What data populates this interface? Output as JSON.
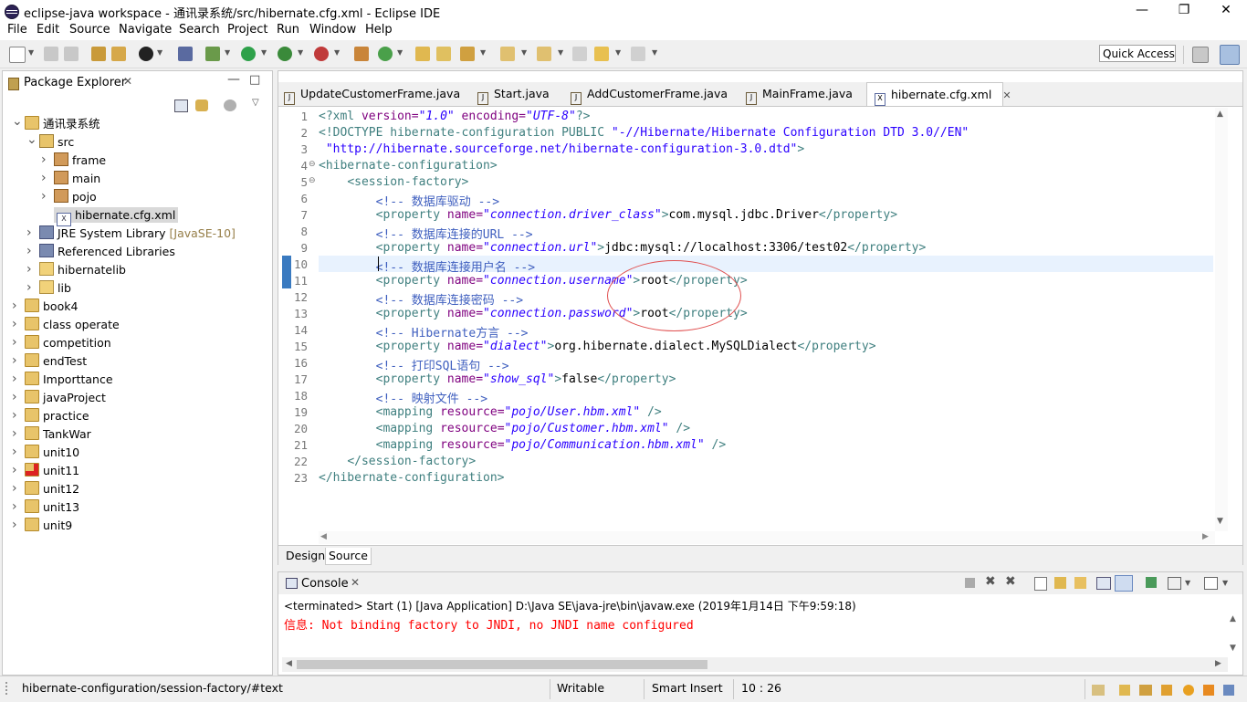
{
  "window": {
    "title": "eclipse-java workspace - 通讯录系统/src/hibernate.cfg.xml - Eclipse IDE",
    "minimize": "—",
    "restore": "❐",
    "close": "✕"
  },
  "menu": [
    "File",
    "Edit",
    "Source",
    "Navigate",
    "Search",
    "Project",
    "Run",
    "Window",
    "Help"
  ],
  "toolbar": {
    "quick_access": "Quick Access"
  },
  "package_explorer": {
    "title": "Package Explorer",
    "tree": [
      {
        "label": "通讯录系统",
        "icon": "project-icon",
        "expanded": true
      },
      {
        "label": "src",
        "icon": "source-folder-icon",
        "expanded": true
      },
      {
        "label": "frame",
        "icon": "package-icon"
      },
      {
        "label": "main",
        "icon": "package-icon"
      },
      {
        "label": "pojo",
        "icon": "package-icon"
      },
      {
        "label": "hibernate.cfg.xml",
        "icon": "xml-file-icon",
        "selected": true
      },
      {
        "label": "JRE System Library",
        "suffix": "[JavaSE-10]",
        "icon": "library-icon"
      },
      {
        "label": "Referenced Libraries",
        "icon": "library-icon"
      },
      {
        "label": "hibernatelib",
        "icon": "folder-icon"
      },
      {
        "label": "lib",
        "icon": "folder-icon"
      },
      {
        "label": "book4",
        "icon": "project-icon"
      },
      {
        "label": "class operate",
        "icon": "project-icon"
      },
      {
        "label": "competition",
        "icon": "project-icon"
      },
      {
        "label": "endTest",
        "icon": "project-icon"
      },
      {
        "label": "Importtance",
        "icon": "project-icon"
      },
      {
        "label": "javaProject",
        "icon": "project-icon"
      },
      {
        "label": "practice",
        "icon": "project-icon"
      },
      {
        "label": "TankWar",
        "icon": "project-icon"
      },
      {
        "label": "unit10",
        "icon": "project-icon"
      },
      {
        "label": "unit11",
        "icon": "project-icon-error"
      },
      {
        "label": "unit12",
        "icon": "project-icon"
      },
      {
        "label": "unit13",
        "icon": "project-icon"
      },
      {
        "label": "unit9",
        "icon": "project-icon"
      }
    ]
  },
  "editor": {
    "tabs": [
      {
        "label": "UpdateCustomerFrame.java"
      },
      {
        "label": "Start.java"
      },
      {
        "label": "AddCustomerFrame.java"
      },
      {
        "label": "MainFrame.java"
      },
      {
        "label": "hibernate.cfg.xml",
        "active": true
      }
    ],
    "bottom_tabs": [
      "Design",
      "Source"
    ],
    "lines": [
      [
        [
          "t-dt",
          "<?xml "
        ],
        [
          "t-attr",
          "version="
        ],
        [
          "t-val",
          "\"1.0\""
        ],
        [
          "t-attr",
          " encoding="
        ],
        [
          "t-val",
          "\"UTF-8\""
        ],
        [
          "t-dt",
          "?>"
        ]
      ],
      [
        [
          "t-dt",
          "<!DOCTYPE hibernate-configuration "
        ],
        [
          "t-dt",
          "PUBLIC "
        ],
        [
          "t-str",
          "\"-//Hibernate/Hibernate Configuration DTD 3.0//EN\""
        ]
      ],
      [
        [
          "t-str",
          " \"http://hibernate.sourceforge.net/hibernate-configuration-3.0.dtd\""
        ],
        [
          "t-dt",
          ">"
        ]
      ],
      [
        [
          "t-tag",
          "<hibernate-configuration>"
        ]
      ],
      [
        [
          "t-txt",
          "    "
        ],
        [
          "t-tag",
          "<session-factory>"
        ]
      ],
      [
        [
          "t-txt",
          "        "
        ],
        [
          "t-com",
          "<!-- 数据库驱动 -->"
        ]
      ],
      [
        [
          "t-txt",
          "        "
        ],
        [
          "t-tag",
          "<property "
        ],
        [
          "t-attr",
          "name="
        ],
        [
          "t-val",
          "\"connection.driver_class\""
        ],
        [
          "t-tag",
          ">"
        ],
        [
          "t-txt",
          "com.mysql.jdbc.Driver"
        ],
        [
          "t-tag",
          "</property>"
        ]
      ],
      [
        [
          "t-txt",
          "        "
        ],
        [
          "t-com",
          "<!-- 数据库连接的URL -->"
        ]
      ],
      [
        [
          "t-txt",
          "        "
        ],
        [
          "t-tag",
          "<property "
        ],
        [
          "t-attr",
          "name="
        ],
        [
          "t-val",
          "\"connection.url\""
        ],
        [
          "t-tag",
          ">"
        ],
        [
          "t-txt",
          "jdbc:mysql://localhost:3306/test02"
        ],
        [
          "t-tag",
          "</property>"
        ]
      ],
      [
        [
          "t-txt",
          "        "
        ],
        [
          "t-com",
          "<!-- 数据库连接用户名 -->"
        ]
      ],
      [
        [
          "t-txt",
          "        "
        ],
        [
          "t-tag",
          "<property "
        ],
        [
          "t-attr",
          "name="
        ],
        [
          "t-val",
          "\"connection.username\""
        ],
        [
          "t-tag",
          ">"
        ],
        [
          "t-txt",
          "root"
        ],
        [
          "t-tag",
          "</property>"
        ]
      ],
      [
        [
          "t-txt",
          "        "
        ],
        [
          "t-com",
          "<!-- 数据库连接密码 -->"
        ]
      ],
      [
        [
          "t-txt",
          "        "
        ],
        [
          "t-tag",
          "<property "
        ],
        [
          "t-attr",
          "name="
        ],
        [
          "t-val",
          "\"connection.password\""
        ],
        [
          "t-tag",
          ">"
        ],
        [
          "t-txt",
          "root"
        ],
        [
          "t-tag",
          "</property>"
        ]
      ],
      [
        [
          "t-txt",
          "        "
        ],
        [
          "t-com",
          "<!-- Hibernate方言 -->"
        ]
      ],
      [
        [
          "t-txt",
          "        "
        ],
        [
          "t-tag",
          "<property "
        ],
        [
          "t-attr",
          "name="
        ],
        [
          "t-val",
          "\"dialect\""
        ],
        [
          "t-tag",
          ">"
        ],
        [
          "t-txt",
          "org.hibernate.dialect.MySQLDialect"
        ],
        [
          "t-tag",
          "</property>"
        ]
      ],
      [
        [
          "t-txt",
          "        "
        ],
        [
          "t-com",
          "<!-- 打印SQL语句 -->"
        ]
      ],
      [
        [
          "t-txt",
          "        "
        ],
        [
          "t-tag",
          "<property "
        ],
        [
          "t-attr",
          "name="
        ],
        [
          "t-val",
          "\"show_sql\""
        ],
        [
          "t-tag",
          ">"
        ],
        [
          "t-txt",
          "false"
        ],
        [
          "t-tag",
          "</property>"
        ]
      ],
      [
        [
          "t-txt",
          "        "
        ],
        [
          "t-com",
          "<!-- 映射文件 -->"
        ]
      ],
      [
        [
          "t-txt",
          "        "
        ],
        [
          "t-tag",
          "<mapping "
        ],
        [
          "t-attr",
          "resource="
        ],
        [
          "t-val",
          "\"pojo/User.hbm.xml\""
        ],
        [
          "t-tag",
          " />"
        ]
      ],
      [
        [
          "t-txt",
          "        "
        ],
        [
          "t-tag",
          "<mapping "
        ],
        [
          "t-attr",
          "resource="
        ],
        [
          "t-val",
          "\"pojo/Customer.hbm.xml\""
        ],
        [
          "t-tag",
          " />"
        ]
      ],
      [
        [
          "t-txt",
          "        "
        ],
        [
          "t-tag",
          "<mapping "
        ],
        [
          "t-attr",
          "resource="
        ],
        [
          "t-val",
          "\"pojo/Communication.hbm.xml\""
        ],
        [
          "t-tag",
          " />"
        ]
      ],
      [
        [
          "t-txt",
          "    "
        ],
        [
          "t-tag",
          "</session-factory>"
        ]
      ],
      [
        [
          "t-tag",
          "</hibernate-configuration>"
        ]
      ]
    ],
    "folded_markers": [
      4,
      5
    ],
    "current_line": 10
  },
  "console": {
    "title": "Console",
    "terminated": "<terminated> Start (1) [Java Application] D:\\Java SE\\java-jre\\bin\\javaw.exe (2019年1月14日 下午9:59:18)",
    "output": "信息: Not binding factory to JNDI, no JNDI name configured",
    "output_color": "#ff0000"
  },
  "status": {
    "path": "hibernate-configuration/session-factory/#text",
    "writable": "Writable",
    "insert_mode": "Smart Insert",
    "position": "10 : 26"
  },
  "colors": {
    "annotation_circle": "#e05050",
    "selection": "#d9d9d9",
    "current_line": "#e8f2fe"
  }
}
